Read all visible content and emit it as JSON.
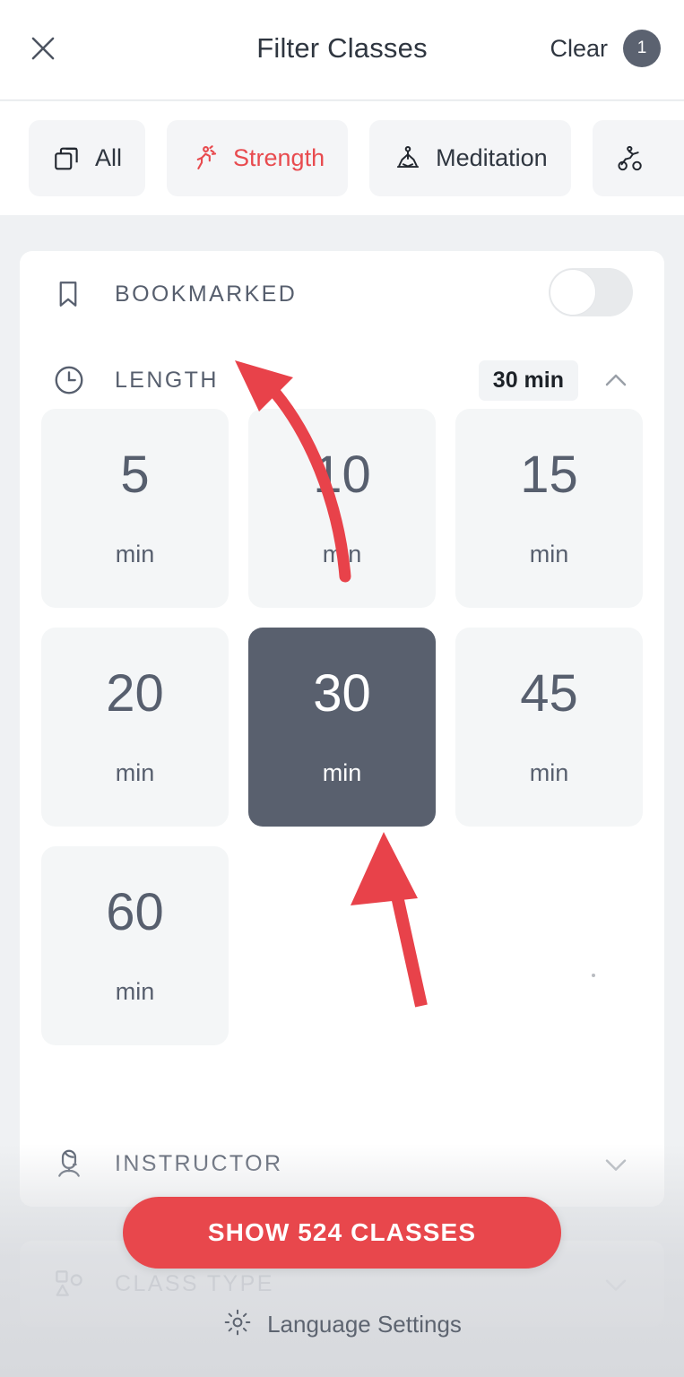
{
  "header": {
    "title": "Filter Classes",
    "close_icon": "close-icon",
    "clear_label": "Clear",
    "clear_badge_count": "1"
  },
  "chips": [
    {
      "label": "All",
      "icon": "stacked-squares-icon",
      "active": false
    },
    {
      "label": "Strength",
      "icon": "running-person-icon",
      "active": true
    },
    {
      "label": "Meditation",
      "icon": "meditation-icon",
      "active": false
    },
    {
      "label": "",
      "icon": "cycling-person-icon",
      "active": false
    }
  ],
  "sections": {
    "bookmarked": {
      "label": "BOOKMARKED",
      "icon": "bookmark-icon",
      "toggle_state": "off"
    },
    "length": {
      "label": "LENGTH",
      "icon": "clock-icon",
      "selected_value": "30 min",
      "chevron": "chevron-up-icon",
      "expanded": true,
      "options": [
        {
          "value": "5",
          "unit": "min",
          "selected": false
        },
        {
          "value": "10",
          "unit": "min",
          "selected": false
        },
        {
          "value": "15",
          "unit": "min",
          "selected": false
        },
        {
          "value": "20",
          "unit": "min",
          "selected": false
        },
        {
          "value": "30",
          "unit": "min",
          "selected": true
        },
        {
          "value": "45",
          "unit": "min",
          "selected": false
        },
        {
          "value": "60",
          "unit": "min",
          "selected": false
        }
      ]
    },
    "instructor": {
      "label": "INSTRUCTOR",
      "icon": "instructor-headset-icon",
      "chevron": "chevron-down-icon"
    },
    "class_type": {
      "label": "CLASS TYPE",
      "icon": "shapes-icon",
      "chevron": "chevron-down-icon"
    }
  },
  "cta": {
    "label": "SHOW 524 CLASSES",
    "count": "524"
  },
  "footer": {
    "language_settings_label": "Language Settings",
    "gear_icon": "gear-icon"
  },
  "colors": {
    "accent_red": "#e8474c",
    "selected_slate": "#59606e",
    "text_slate": "#575f6e",
    "page_bg": "#eff1f3",
    "cell_bg": "#f4f6f7"
  },
  "annotations": {
    "arrow_color": "#e8424a",
    "arrow_curved_target": "LENGTH section header",
    "arrow_straight_target": "30 min selected option"
  }
}
